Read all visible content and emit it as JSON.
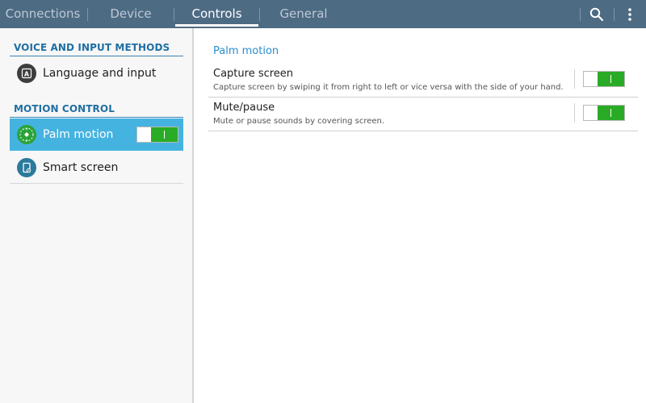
{
  "tabs": [
    {
      "label": "Connections"
    },
    {
      "label": "Device"
    },
    {
      "label": "Controls",
      "active": true
    },
    {
      "label": "General"
    }
  ],
  "toolbar": {
    "search_icon": "search-icon",
    "more_icon": "more-vertical-icon"
  },
  "sidebar": {
    "sections": [
      {
        "header": "VOICE AND INPUT METHODS",
        "items": [
          {
            "label": "Language and input",
            "icon": "keyboard-language-icon"
          }
        ]
      },
      {
        "header": "MOTION CONTROL",
        "items": [
          {
            "label": "Palm motion",
            "icon": "palm-motion-icon",
            "selected": true,
            "toggle": "on"
          },
          {
            "label": "Smart screen",
            "icon": "smart-screen-icon"
          }
        ]
      }
    ]
  },
  "main": {
    "title": "Palm motion",
    "settings": [
      {
        "title": "Capture screen",
        "description": "Capture screen by swiping it from right to left or vice versa with the side of your hand.",
        "toggle": "on"
      },
      {
        "title": "Mute/pause",
        "description": "Mute or pause sounds by covering screen.",
        "toggle": "on"
      }
    ]
  },
  "colors": {
    "topbar": "#4e6b84",
    "selected": "#45b3e0",
    "toggle_on": "#2aab26",
    "accent_text": "#2a8fcc"
  }
}
